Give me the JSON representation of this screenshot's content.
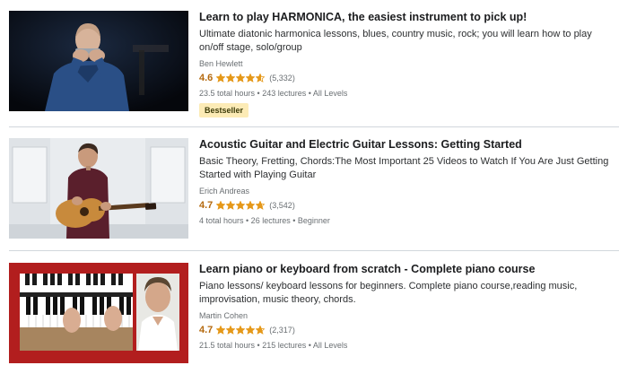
{
  "courses": [
    {
      "title": "Learn to play HARMONICA, the easiest instrument to pick up!",
      "headline": "Ultimate diatonic harmonica lessons, blues, country music, rock; you will learn how to play on/off stage, solo/group",
      "instructor": "Ben Hewlett",
      "rating": "4.6",
      "rating_value": 4.6,
      "rating_count": "(5,332)",
      "meta": "23.5 total hours • 243 lectures • All Levels",
      "badge": "Bestseller",
      "thumbnail_icon": "harmonica-player-photo"
    },
    {
      "title": "Acoustic Guitar and Electric Guitar Lessons: Getting Started",
      "headline": "Basic Theory, Fretting, Chords:The Most Important 25 Videos to Watch If You Are Just Getting Started with Playing Guitar",
      "instructor": "Erich Andreas",
      "rating": "4.7",
      "rating_value": 4.7,
      "rating_count": "(3,542)",
      "meta": "4 total hours • 26 lectures • Beginner",
      "thumbnail_icon": "guitar-player-photo"
    },
    {
      "title": "Learn piano or keyboard from scratch - Complete piano course",
      "headline": "Piano lessons/ keyboard lessons for beginners. Complete piano course,reading music, improvisation, music theory, chords.",
      "instructor": "Martin Cohen",
      "rating": "4.7",
      "rating_value": 4.7,
      "rating_count": "(2,317)",
      "meta": "21.5 total hours • 215 lectures • All Levels",
      "thumbnail_icon": "piano-keyboard-photo"
    }
  ],
  "colors": {
    "rating": "#b4690e",
    "star": "#e59819",
    "badge_bg": "#fcebb6",
    "divider": "#d1d7dc"
  }
}
